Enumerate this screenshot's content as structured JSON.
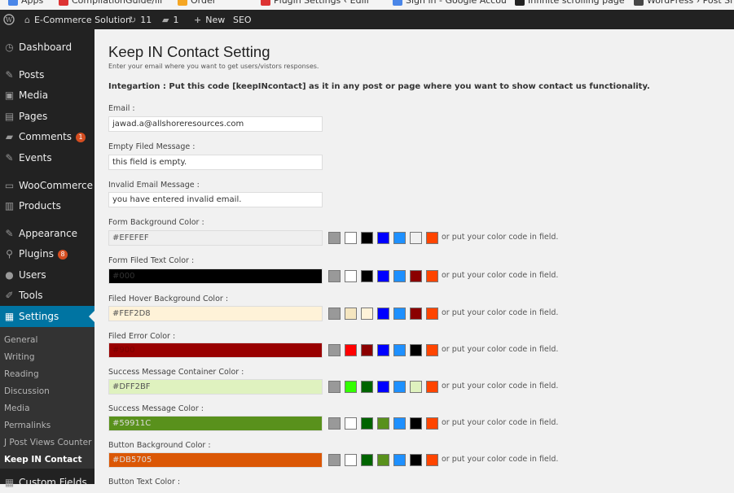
{
  "bookmarks": [
    {
      "label": "Apps",
      "color": "#4a86e8"
    },
    {
      "label": "CompilationGuide/lli",
      "color": "#d33"
    },
    {
      "label": "Order",
      "color": "#f5a623"
    },
    {
      "label": "Plugin Settings ‹ Edili",
      "color": "#d33"
    },
    {
      "label": "Sign in - Google Accou",
      "color": "#4a86e8"
    },
    {
      "label": "Infinite scrolling page",
      "color": "#222"
    },
    {
      "label": "WordPress › Post Sl",
      "color": "#464646"
    }
  ],
  "adminbar": {
    "wp_logo": "wordpress-logo-icon",
    "site_name": "E-Commerce Solution",
    "updates_count": "11",
    "comments_count": "1",
    "new_label": "New",
    "seo_label": "SEO"
  },
  "sidebar": {
    "items": [
      {
        "label": "Dashboard",
        "icon": "dashboard-icon",
        "glyph": "◷"
      },
      {
        "label": "Posts",
        "icon": "pin-icon",
        "glyph": "✎"
      },
      {
        "label": "Media",
        "icon": "media-icon",
        "glyph": "▣"
      },
      {
        "label": "Pages",
        "icon": "pages-icon",
        "glyph": "▤"
      },
      {
        "label": "Comments",
        "icon": "comments-icon",
        "glyph": "▰",
        "badge": "1"
      },
      {
        "label": "Events",
        "icon": "events-icon",
        "glyph": "✎"
      },
      {
        "label": "WooCommerce",
        "icon": "woocommerce-icon",
        "glyph": "▭"
      },
      {
        "label": "Products",
        "icon": "products-icon",
        "glyph": "▥"
      },
      {
        "label": "Appearance",
        "icon": "appearance-icon",
        "glyph": "✎"
      },
      {
        "label": "Plugins",
        "icon": "plugins-icon",
        "glyph": "⚲",
        "badge": "8"
      },
      {
        "label": "Users",
        "icon": "users-icon",
        "glyph": "●"
      },
      {
        "label": "Tools",
        "icon": "tools-icon",
        "glyph": "✐"
      },
      {
        "label": "Settings",
        "icon": "settings-icon",
        "glyph": "▦",
        "active": true
      }
    ],
    "submenu": [
      {
        "label": "General"
      },
      {
        "label": "Writing"
      },
      {
        "label": "Reading"
      },
      {
        "label": "Discussion"
      },
      {
        "label": "Media"
      },
      {
        "label": "Permalinks"
      },
      {
        "label": "J Post Views Counter"
      },
      {
        "label": "Keep IN Contact",
        "current": true
      }
    ],
    "last_item": {
      "label": "Custom Fields",
      "icon": "custom-fields-icon"
    }
  },
  "page": {
    "title": "Keep IN Contact Setting",
    "description": "Enter your email where you want to get users/vistors responses.",
    "integration": "Integartion : Put this code [keepINcontact] as it in any post or page where you want to show contact us functionality."
  },
  "fields": [
    {
      "label": "Email :",
      "value": "jawad.a@allshoreresources.com",
      "bg": "#ffffff",
      "fg": "#333333"
    },
    {
      "label": "Empty Filed Message :",
      "value": "this field is empty.",
      "bg": "#ffffff",
      "fg": "#333333"
    },
    {
      "label": "Invalid Email Message :",
      "value": "you have entered invalid email.",
      "bg": "#ffffff",
      "fg": "#333333"
    }
  ],
  "color_fields": [
    {
      "label": "Form Background Color :",
      "value": "#EFEFEF",
      "bg": "#EFEFEF",
      "fg": "#555555",
      "swatches": [
        "#999999",
        "#ffffff",
        "#000000",
        "#0000ff",
        "#1e90ff",
        "#f0f0f0",
        "#ff4500"
      ]
    },
    {
      "label": "Form Filed Text Color :",
      "value": "#000",
      "bg": "#000000",
      "fg": "#333333",
      "swatches": [
        "#999999",
        "#ffffff",
        "#000000",
        "#0000ff",
        "#1e90ff",
        "#8b0000",
        "#ff4500"
      ]
    },
    {
      "label": "Filed Hover Background Color :",
      "value": "#FEF2D8",
      "bg": "#FEF2D8",
      "fg": "#555555",
      "swatches": [
        "#999999",
        "#f5e6c0",
        "#fef2d8",
        "#0000ff",
        "#1e90ff",
        "#8b0000",
        "#ff4500"
      ]
    },
    {
      "label": "Filed Error Color :",
      "value": "#900",
      "bg": "#990000",
      "fg": "#7a0000",
      "swatches": [
        "#999999",
        "#ff0000",
        "#8b0000",
        "#0000ff",
        "#1e90ff",
        "#000000",
        "#ff4500"
      ]
    },
    {
      "label": "Success Message Container Color :",
      "value": "#DFF2BF",
      "bg": "#DFF2BF",
      "fg": "#555555",
      "swatches": [
        "#999999",
        "#33ff00",
        "#006400",
        "#0000ff",
        "#1e90ff",
        "#dff2bf",
        "#ff4500"
      ]
    },
    {
      "label": "Success Message Color :",
      "value": "#59911C",
      "bg": "#59911C",
      "fg": "#dddddd",
      "swatches": [
        "#999999",
        "#ffffff",
        "#006400",
        "#59911c",
        "#1e90ff",
        "#000000",
        "#ff4500"
      ]
    },
    {
      "label": "Button Background Color :",
      "value": "#DB5705",
      "bg": "#DB5705",
      "fg": "#dddddd",
      "swatches": [
        "#999999",
        "#ffffff",
        "#006400",
        "#59911c",
        "#1e90ff",
        "#000000",
        "#ff4500"
      ]
    }
  ],
  "color_hint": "or put your color code in field.",
  "trailing_label": "Button Text Color :"
}
